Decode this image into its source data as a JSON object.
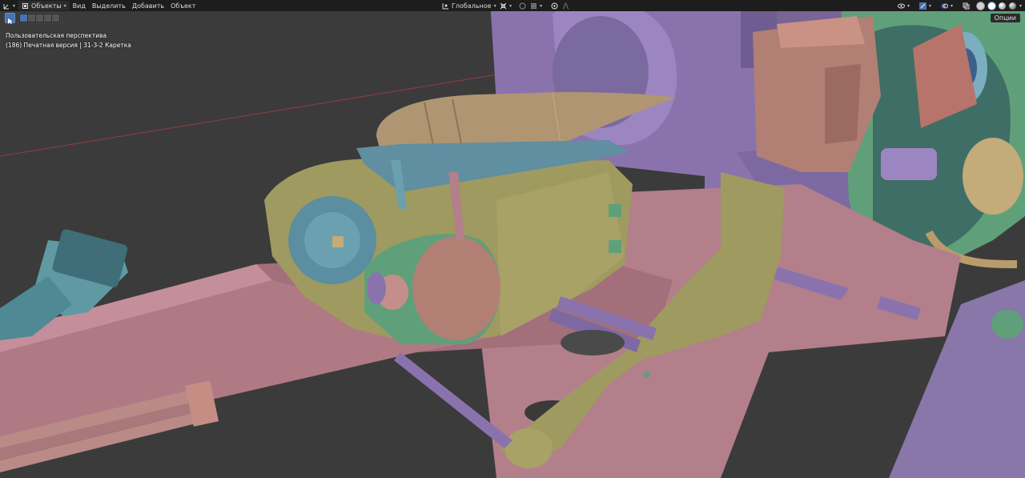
{
  "header": {
    "menu_objects": "Объекты",
    "menu_view": "Вид",
    "menu_select": "Выделить",
    "menu_add": "Добавить",
    "menu_object": "Объект",
    "transform_orientation": "Глобальное"
  },
  "toolbar": {
    "options_label": "Опции"
  },
  "viewport_info": {
    "perspective": "Пользовательская перспектива",
    "collection": "(186) Печатная версия | 31-3-2 Каретка"
  }
}
